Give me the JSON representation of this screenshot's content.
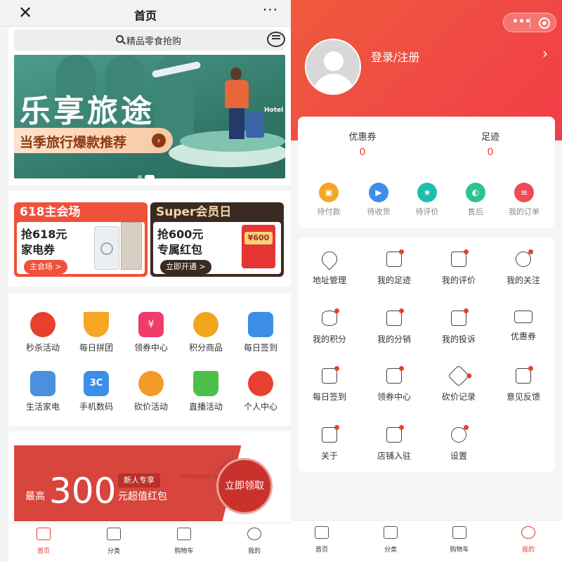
{
  "left": {
    "nav": {
      "title": "首页",
      "close_icon": "close-icon",
      "more": "···"
    },
    "search": {
      "placeholder": "精品零食抢购"
    },
    "banner": {
      "title": "乐享旅途",
      "subtitle": "当季旅行爆款推荐",
      "tag": "Hotel",
      "slide_index": 2,
      "slide_count": 2
    },
    "promos": [
      {
        "head": "618主会场",
        "line1": "抢618元",
        "line2": "家电券",
        "button": "主会场 >"
      },
      {
        "head": "Super会员日",
        "line1": "抢600元",
        "line2": "专属红包",
        "button": "立即开通 >",
        "badge": "¥600"
      }
    ],
    "grid": [
      {
        "label": "秒杀活动",
        "color": "#e8402e"
      },
      {
        "label": "每日拼团",
        "color": "#f5a623"
      },
      {
        "label": "领券中心",
        "color": "#ef3c6a"
      },
      {
        "label": "积分商品",
        "color": "#f2a51c"
      },
      {
        "label": "每日签到",
        "color": "#3d8ee8"
      },
      {
        "label": "生活家电",
        "color": "#4a8fe0"
      },
      {
        "label": "手机数码",
        "color": "#3d8ee8"
      },
      {
        "label": "砍价活动",
        "color": "#f49a26"
      },
      {
        "label": "直播活动",
        "color": "#4cbf4a"
      },
      {
        "label": "个人中心",
        "color": "#e8402e"
      }
    ],
    "coupon": {
      "prefix": "最高",
      "amount": "300",
      "suffix": "元超值红包",
      "tag": "新人专享",
      "claim": "立即领取",
      "watermark": "一条"
    },
    "tabs": [
      {
        "label": "首页",
        "icon": "home-icon",
        "active": true
      },
      {
        "label": "分类",
        "icon": "category-icon",
        "active": false
      },
      {
        "label": "购物车",
        "icon": "cart-icon",
        "active": false
      },
      {
        "label": "我的",
        "icon": "user-icon",
        "active": false
      }
    ]
  },
  "right": {
    "login": "登录/注册",
    "stats": [
      {
        "label": "优惠券",
        "value": "0"
      },
      {
        "label": "足迹",
        "value": "0"
      }
    ],
    "orders": [
      {
        "label": "待付款",
        "color": "#f5a623",
        "icon": "wallet-icon"
      },
      {
        "label": "待收货",
        "color": "#3d8ee8",
        "icon": "truck-icon"
      },
      {
        "label": "待评价",
        "color": "#1fbfb0",
        "icon": "star-icon"
      },
      {
        "label": "售后",
        "color": "#2ec28e",
        "icon": "headset-icon"
      },
      {
        "label": "我的订单",
        "color": "#ef4a56",
        "icon": "order-list-icon"
      }
    ],
    "services": [
      {
        "label": "地址管理",
        "icon": "location-icon"
      },
      {
        "label": "我的足迹",
        "icon": "truck-icon"
      },
      {
        "label": "我的评价",
        "icon": "edit-icon"
      },
      {
        "label": "我的关注",
        "icon": "heart-icon"
      },
      {
        "label": "我的积分",
        "icon": "coins-icon"
      },
      {
        "label": "我的分销",
        "icon": "grid-icon"
      },
      {
        "label": "我的投诉",
        "icon": "search-doc-icon"
      },
      {
        "label": "优惠券",
        "icon": "coupon-icon"
      },
      {
        "label": "每日签到",
        "icon": "calendar-check-icon"
      },
      {
        "label": "领券中心",
        "icon": "percent-ticket-icon"
      },
      {
        "label": "砍价记录",
        "icon": "tag-icon"
      },
      {
        "label": "意见反馈",
        "icon": "edit-icon"
      },
      {
        "label": "关于",
        "icon": "about-icon"
      },
      {
        "label": "店铺入驻",
        "icon": "edit-icon"
      },
      {
        "label": "设置",
        "icon": "gear-icon"
      }
    ],
    "tabs": [
      {
        "label": "首页",
        "icon": "home-icon",
        "active": false
      },
      {
        "label": "分类",
        "icon": "category-icon",
        "active": false
      },
      {
        "label": "购物车",
        "icon": "cart-icon",
        "active": false
      },
      {
        "label": "我的",
        "icon": "user-icon",
        "active": true
      }
    ]
  },
  "colors": {
    "accent": "#e03c31",
    "header_red": "#f04a44",
    "banner_green": "#2f7566"
  }
}
